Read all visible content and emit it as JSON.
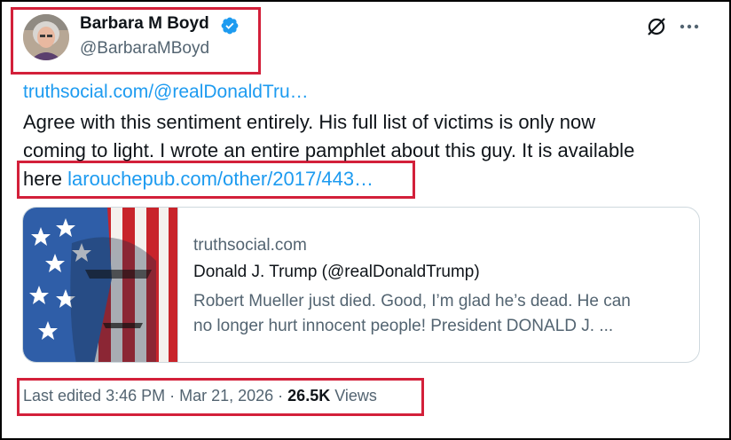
{
  "author": {
    "display_name": "Barbara M Boyd",
    "handle": "@BarbaraMBoyd"
  },
  "post": {
    "link_top": "truthsocial.com/@realDonaldTru…",
    "text_line1": "Agree with this sentiment entirely.  His full list of victims is only now",
    "text_line2": "coming to light.  I wrote an entire pamphlet about this guy.  It is available",
    "text_line3_prefix": "here ",
    "link_inline": "larouchepub.com/other/2017/443…"
  },
  "card": {
    "domain": "truthsocial.com",
    "title": "Donald J. Trump (@realDonaldTrump)",
    "desc_line1": "Robert Mueller just died. Good, I’m glad he’s dead. He can",
    "desc_line2": "no longer hurt innocent people! President DONALD J. ..."
  },
  "meta": {
    "edited_prefix": "Last edited 3:46 PM · Mar 21, 2026 · ",
    "views_count": "26.5K",
    "views_label": " Views"
  },
  "icons": {
    "verified": "verified-badge-icon",
    "grok": "grok-icon",
    "more": "more-options-icon"
  },
  "colors": {
    "link": "#1d9bf0",
    "secondary_text": "#536471",
    "highlight": "#d3203a",
    "verified": "#1d9bf0"
  }
}
